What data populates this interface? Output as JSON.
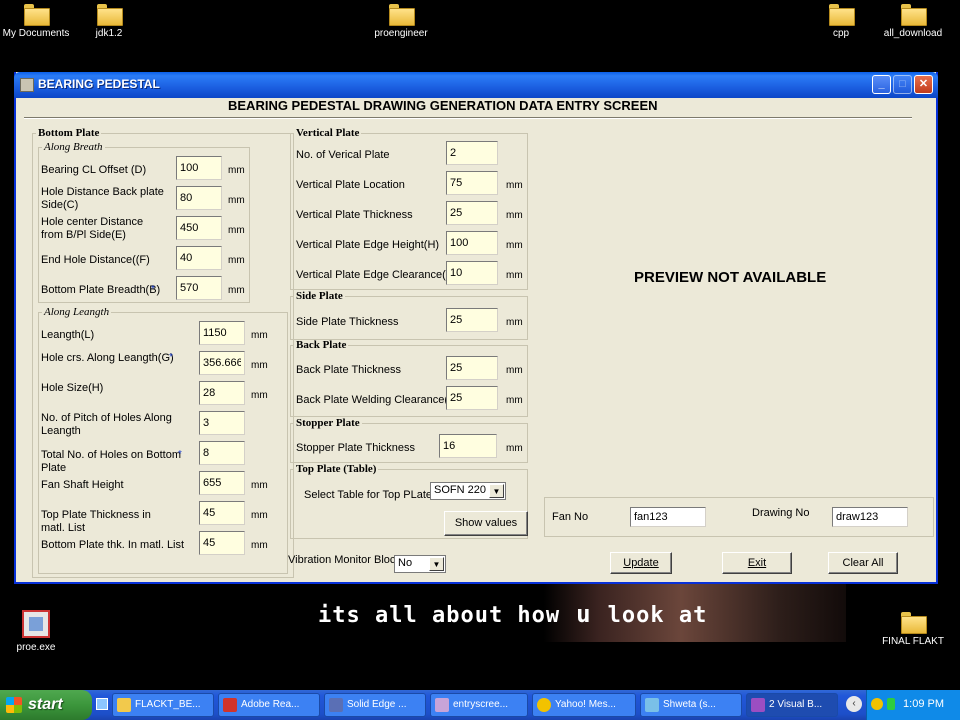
{
  "desktop": {
    "icons": [
      {
        "label": "My Documents"
      },
      {
        "label": "jdk1.2"
      },
      {
        "label": "proengineer"
      },
      {
        "label": "cpp"
      },
      {
        "label": "all_download"
      },
      {
        "label": "proe.exe"
      },
      {
        "label": "FINAL FLAKT"
      }
    ],
    "banner_text_1": "its all about how",
    "banner_text_u": "u",
    "banner_text_2": "look at"
  },
  "window": {
    "title": "BEARING PEDESTAL",
    "heading": "BEARING PEDESTAL DRAWING GENERATION  DATA ENTRY SCREEN",
    "controls": {
      "minimize": "_",
      "maximize": "□",
      "close": "✕"
    }
  },
  "bottom_plate": {
    "legend": "Bottom Plate",
    "along_breath": {
      "legend": "Along Breath",
      "fields": [
        {
          "label": "Bearing CL Offset (D)",
          "value": "100",
          "unit": "mm"
        },
        {
          "label": "Hole Distance Back plate Side(C)",
          "value": "80",
          "unit": "mm"
        },
        {
          "label": "Hole center  Distance from B/Pl Side(E)",
          "value": "450",
          "unit": "mm"
        },
        {
          "label": "End Hole Distance((F)",
          "value": "40",
          "unit": "mm"
        },
        {
          "label": "Bottom Plate Breadth(B)",
          "value": "570",
          "unit": "mm",
          "star": "*"
        }
      ]
    },
    "along_length": {
      "legend": "Along Leangth",
      "fields": [
        {
          "label": "Leangth(L)",
          "value": "1150",
          "unit": "mm"
        },
        {
          "label": "Hole crs. Along Leangth(G)",
          "value": "356.666",
          "unit": "mm",
          "star": "*"
        },
        {
          "label": "Hole Size(H)",
          "value": "28",
          "unit": "mm"
        },
        {
          "label": "No. of Pitch of Holes Along Leangth",
          "value": "3",
          "unit": ""
        },
        {
          "label": "Total No. of Holes on Bottom Plate",
          "value": "8",
          "unit": "",
          "star": "*"
        },
        {
          "label": "Fan Shaft Height",
          "value": "655",
          "unit": "mm"
        },
        {
          "label": "Top Plate Thickness in matl. List",
          "value": "45",
          "unit": "mm"
        },
        {
          "label": "Bottom Plate thk. In matl. List",
          "value": "45",
          "unit": "mm"
        }
      ]
    }
  },
  "vertical_plate": {
    "legend": "Vertical Plate",
    "fields": [
      {
        "label": "No. of Verical Plate",
        "value": "2",
        "unit": ""
      },
      {
        "label": "Vertical Plate Location",
        "value": "75",
        "unit": "mm"
      },
      {
        "label": "Vertical Plate Thickness",
        "value": "25",
        "unit": "mm"
      },
      {
        "label": "Vertical Plate Edge Height(H)",
        "value": "100",
        "unit": "mm"
      },
      {
        "label": "Vertical Plate Edge Clearance(L)",
        "value": "10",
        "unit": "mm"
      }
    ]
  },
  "side_plate": {
    "legend": "Side Plate",
    "fields": [
      {
        "label": "Side Plate Thickness",
        "value": "25",
        "unit": "mm"
      }
    ]
  },
  "back_plate": {
    "legend": "Back Plate",
    "fields": [
      {
        "label": "Back Plate Thickness",
        "value": "25",
        "unit": "mm"
      },
      {
        "label": "Back Plate Welding Clearance(A)",
        "value": "25",
        "unit": "mm"
      }
    ]
  },
  "stopper_plate": {
    "legend": "Stopper Plate",
    "fields": [
      {
        "label": "Stopper Plate Thickness",
        "value": "16",
        "unit": "mm"
      }
    ]
  },
  "top_plate": {
    "legend": "Top Plate (Table)",
    "select_label": "Select Table for Top PLate",
    "select_value": "SOFN 220",
    "show_values_label": "Show values"
  },
  "vibration": {
    "label": "Vibration Monitor Block",
    "value": "No"
  },
  "preview": {
    "text": "PREVIEW NOT AVAILABLE"
  },
  "info": {
    "fan_no_label": "Fan No",
    "fan_no_value": "fan123",
    "drawing_no_label": "Drawing No",
    "drawing_no_value": "draw123"
  },
  "actions": {
    "update": "Update",
    "exit": "Exit",
    "clear_all": "Clear All"
  },
  "taskbar": {
    "start": "start",
    "tasks": [
      {
        "label": "FLACKT_BE...",
        "icon_color": "#f2c94c"
      },
      {
        "label": "Adobe Rea...",
        "icon_color": "#d0342c"
      },
      {
        "label": "Solid Edge ...",
        "icon_color": "#5a6fb5"
      },
      {
        "label": "entryscree...",
        "icon_color": "#c8a4d8"
      },
      {
        "label": "Yahoo! Mes...",
        "icon_color": "#f2c200"
      },
      {
        "label": "Shweta  (s...",
        "icon_color": "#7ac0e8"
      },
      {
        "label": "2 Visual B...",
        "icon_color": "#9b4ec2"
      }
    ],
    "clock": "1:09 PM"
  }
}
